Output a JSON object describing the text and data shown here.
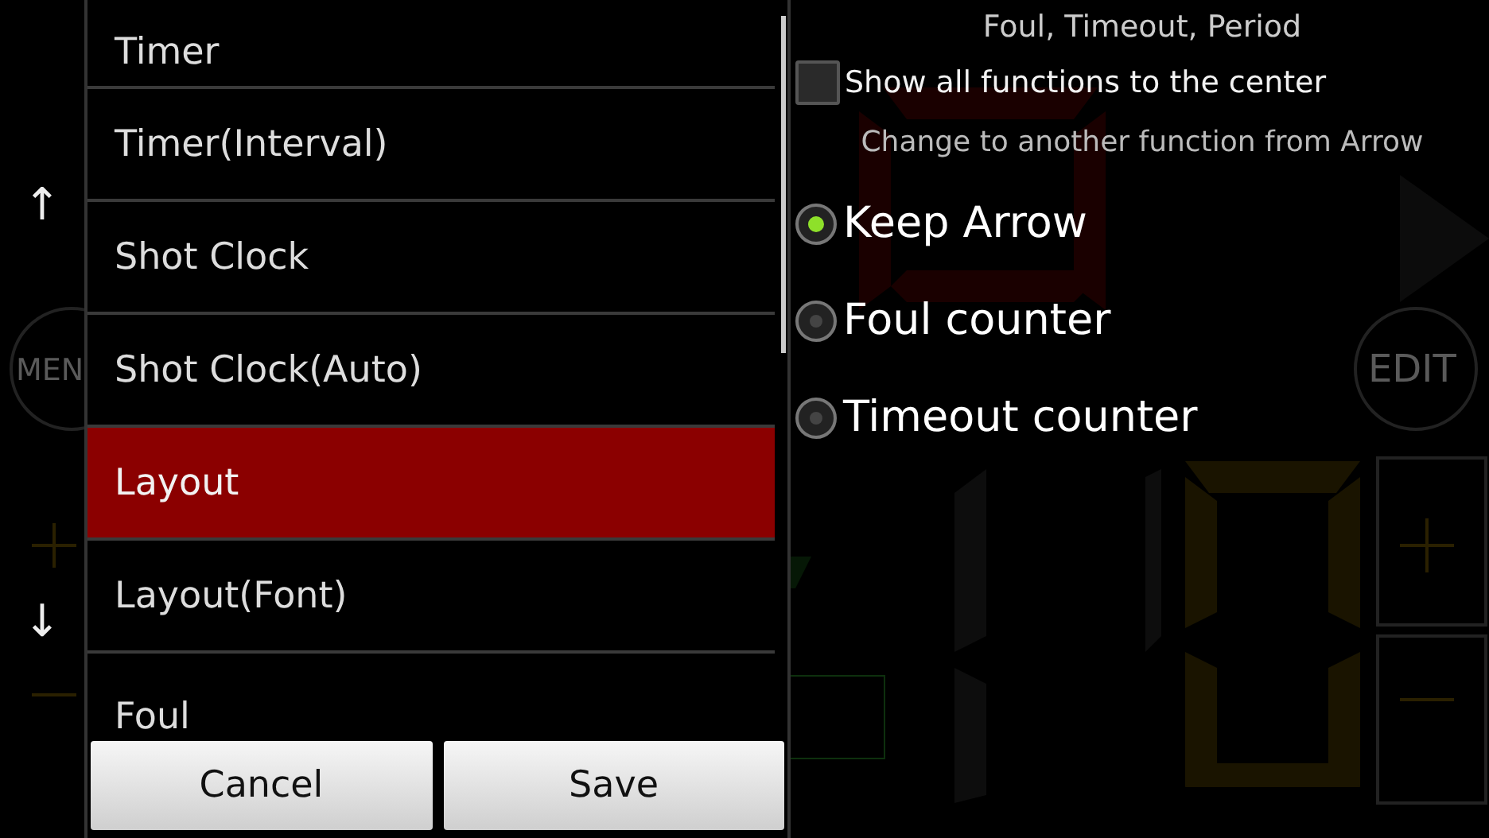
{
  "background": {
    "menu_button": "MEN",
    "edit_button": "EDIT"
  },
  "scroll_arrows": {
    "up": "↑",
    "down": "↓"
  },
  "menu": {
    "items": [
      {
        "label": "Timer",
        "selected": false
      },
      {
        "label": "Timer(Interval)",
        "selected": false
      },
      {
        "label": "Shot Clock",
        "selected": false
      },
      {
        "label": "Shot Clock(Auto)",
        "selected": false
      },
      {
        "label": "Layout",
        "selected": true
      },
      {
        "label": "Layout(Font)",
        "selected": false
      },
      {
        "label": "Foul",
        "selected": false
      }
    ]
  },
  "settings": {
    "title": "Foul, Timeout, Period",
    "show_all": {
      "label": "Show all functions to the center",
      "checked": false
    },
    "subtitle": "Change to another function from Arrow",
    "options": [
      {
        "label": "Keep Arrow",
        "selected": true
      },
      {
        "label": "Foul counter",
        "selected": false
      },
      {
        "label": "Timeout counter",
        "selected": false
      }
    ]
  },
  "buttons": [
    "Cancel",
    "Save"
  ]
}
